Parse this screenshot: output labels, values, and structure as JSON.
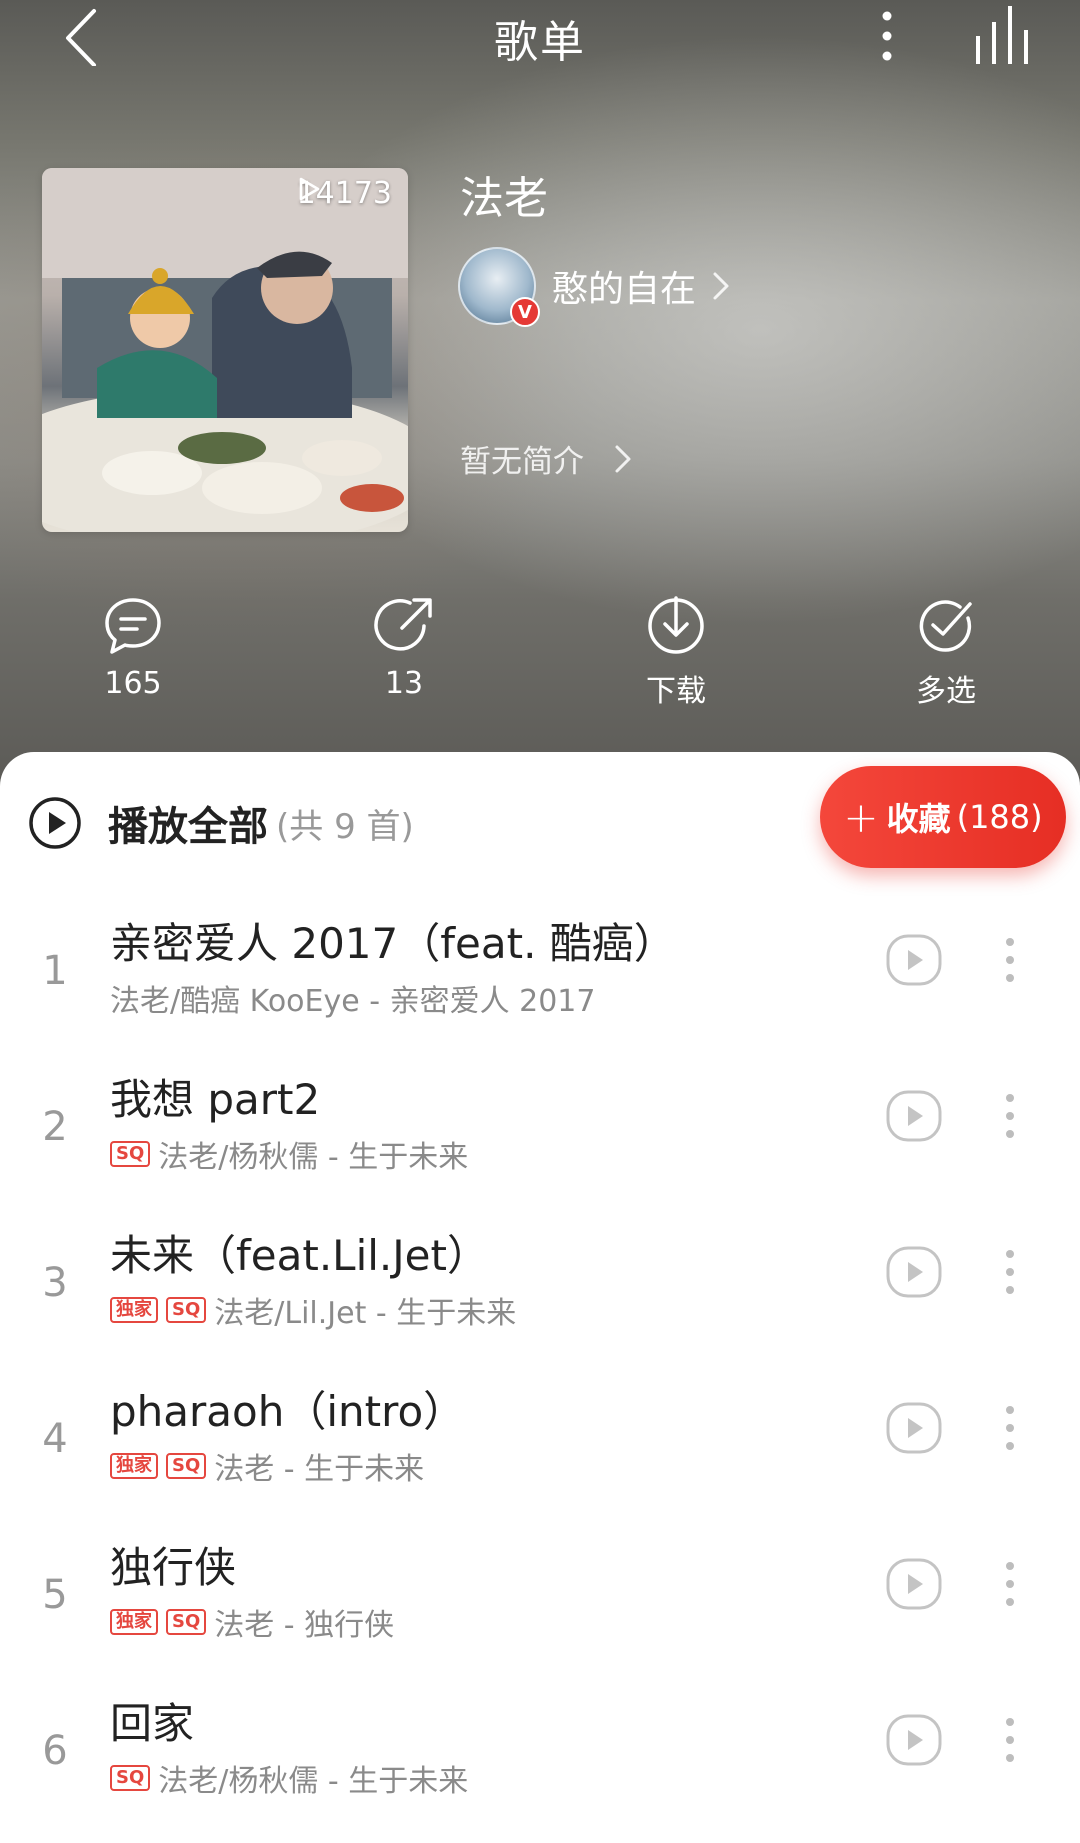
{
  "nav": {
    "title": "歌单"
  },
  "playlist": {
    "play_count": "14173",
    "title": "法老",
    "creator_name": "憨的自在",
    "creator_badge": "V",
    "description": "暂无简介"
  },
  "actions": {
    "comment_count": "165",
    "share_count": "13",
    "download_label": "下载",
    "multi_select_label": "多选"
  },
  "list": {
    "play_all_label": "播放全部",
    "play_all_count": "(共 9 首)",
    "fav_label": "收藏",
    "fav_count": "(188)"
  },
  "tags": {
    "exclusive": "独家",
    "sq": "SQ"
  },
  "songs": [
    {
      "index": "1",
      "title": "亲密爱人 2017（feat. 酷癌）",
      "exclusive": false,
      "sq": false,
      "meta": "法老/酷癌 KooEye - 亲密爱人 2017"
    },
    {
      "index": "2",
      "title": "我想 part2",
      "exclusive": false,
      "sq": true,
      "meta": "法老/杨秋儒 - 生于未来"
    },
    {
      "index": "3",
      "title": "未来（feat.Lil.Jet）",
      "exclusive": true,
      "sq": true,
      "meta": "法老/Lil.Jet - 生于未来"
    },
    {
      "index": "4",
      "title": "pharaoh（intro）",
      "exclusive": true,
      "sq": true,
      "meta": "法老 - 生于未来"
    },
    {
      "index": "5",
      "title": "独行侠",
      "exclusive": true,
      "sq": true,
      "meta": "法老 - 独行侠"
    },
    {
      "index": "6",
      "title": "回家",
      "exclusive": false,
      "sq": true,
      "meta": "法老/杨秋儒 - 生于未来"
    }
  ],
  "colors": {
    "accent": "#e62e24",
    "text": "#222222",
    "subtext": "#8a8a8a"
  }
}
